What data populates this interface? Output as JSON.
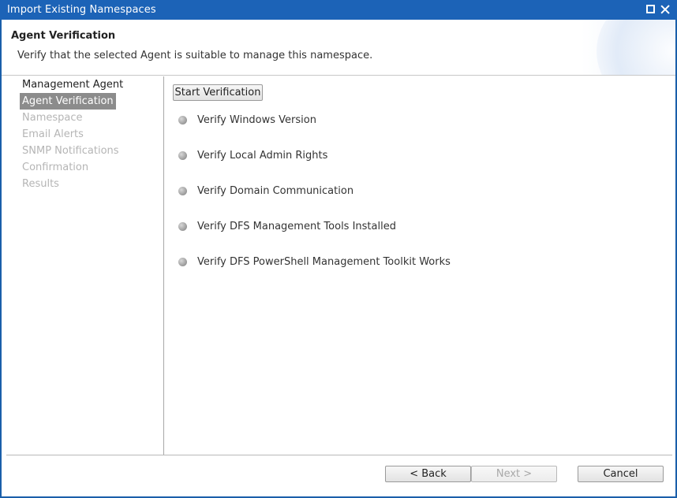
{
  "window": {
    "title": "Import Existing Namespaces"
  },
  "header": {
    "title": "Agent Verification",
    "description": "Verify that the selected Agent is suitable to manage this namespace."
  },
  "nav": {
    "items": [
      {
        "label": "Management Agent",
        "state": "done"
      },
      {
        "label": "Agent Verification",
        "state": "active"
      },
      {
        "label": "Namespace",
        "state": "future"
      },
      {
        "label": "Email Alerts",
        "state": "future"
      },
      {
        "label": "SNMP Notifications",
        "state": "future"
      },
      {
        "label": "Confirmation",
        "state": "future"
      },
      {
        "label": "Results",
        "state": "future"
      }
    ]
  },
  "main": {
    "start_button": "Start Verification",
    "checks": [
      {
        "label": "Verify Windows Version",
        "status_icon": "pending-bullet-icon"
      },
      {
        "label": "Verify Local Admin Rights",
        "status_icon": "pending-bullet-icon"
      },
      {
        "label": "Verify Domain Communication",
        "status_icon": "pending-bullet-icon"
      },
      {
        "label": "Verify DFS Management Tools Installed",
        "status_icon": "pending-bullet-icon"
      },
      {
        "label": "Verify DFS PowerShell Management Toolkit Works",
        "status_icon": "pending-bullet-icon"
      }
    ]
  },
  "footer": {
    "back_label": "< Back",
    "next_label": "Next >",
    "cancel_label": "Cancel"
  },
  "colors": {
    "titlebar": "#1c63b7",
    "active_nav": "#8c8c8c",
    "disabled_text": "#b5b5b5"
  }
}
